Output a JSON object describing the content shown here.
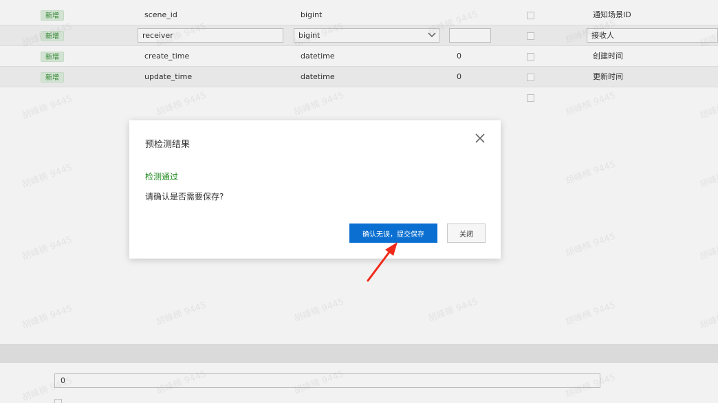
{
  "table": {
    "rows": [
      {
        "tag": "新增",
        "name": "scene_id",
        "type": "bigint",
        "length": "",
        "comment": "通知场景ID",
        "editing": false
      },
      {
        "tag": "新增",
        "name": "receiver",
        "type": "bigint",
        "length": "",
        "comment": "接收人",
        "editing": true
      },
      {
        "tag": "新增",
        "name": "create_time",
        "type": "datetime",
        "length": "0",
        "comment": "创建时间",
        "editing": false
      },
      {
        "tag": "新增",
        "name": "update_time",
        "type": "datetime",
        "length": "0",
        "comment": "更新时间",
        "editing": false
      }
    ]
  },
  "lower": {
    "input_value": "0"
  },
  "watermark": "胡峰楠 9445",
  "dialog": {
    "title": "预检测结果",
    "status": "检测通过",
    "message": "请确认是否需要保存?",
    "confirm_label": "确认无误，提交保存",
    "close_label": "关闭",
    "close_icon": "close-icon"
  },
  "colors": {
    "primary": "#0a6fd1",
    "success": "#1f8a1f",
    "arrow": "#f02a1a"
  }
}
